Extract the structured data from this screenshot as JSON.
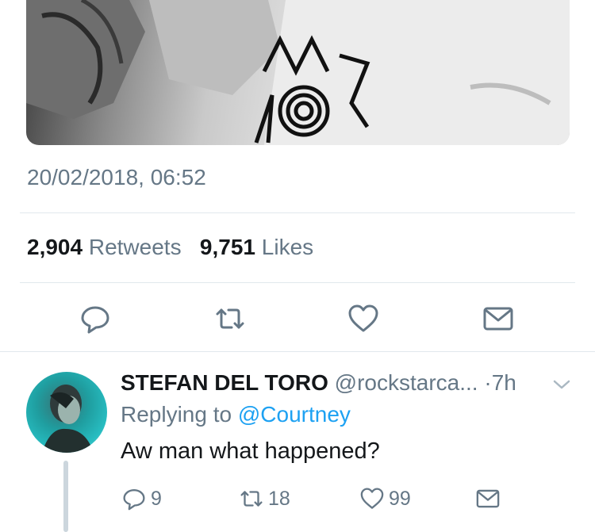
{
  "tweet": {
    "timestamp": "20/02/2018, 06:52",
    "retweets_count": "2,904",
    "retweets_label": "Retweets",
    "likes_count": "9,751",
    "likes_label": "Likes",
    "actions": [
      "reply-icon",
      "retweet-icon",
      "like-icon",
      "share-icon"
    ]
  },
  "reply": {
    "display_name": "STEFAN DEL TORO",
    "handle": "@rockstarca...",
    "separator": "·",
    "time": "7h",
    "replying_prefix": "Replying to",
    "replying_to": "@Courtney",
    "text": "Aw man what happened?",
    "reply_count": "9",
    "retweet_count": "18",
    "like_count": "99"
  },
  "colors": {
    "secondary_text": "#657786",
    "link": "#1da1f2",
    "divider": "#e1e8ed",
    "avatar_teal": "#27bcc0"
  }
}
